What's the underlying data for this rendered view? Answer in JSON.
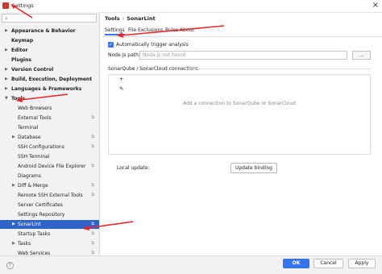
{
  "window": {
    "title": "Settings",
    "close_glyph": "×"
  },
  "sidebar": {
    "search_placeholder": "",
    "items": [
      {
        "label": "Appearance & Behavior",
        "expand": "▶",
        "bold": true
      },
      {
        "label": "Keymap",
        "expand": "",
        "bold": true
      },
      {
        "label": "Editor",
        "expand": "▶",
        "bold": true
      },
      {
        "label": "Plugins",
        "expand": "",
        "bold": true
      },
      {
        "label": "Version Control",
        "expand": "▶",
        "bold": true
      },
      {
        "label": "Build, Execution, Deployment",
        "expand": "▶",
        "bold": true
      },
      {
        "label": "Languages & Frameworks",
        "expand": "▶",
        "bold": true
      },
      {
        "label": "Tools",
        "expand": "▼",
        "bold": true
      },
      {
        "label": "Web Browsers",
        "expand": "",
        "bold": false
      },
      {
        "label": "External Tools",
        "expand": "",
        "bold": false
      },
      {
        "label": "Terminal",
        "expand": "",
        "bold": false
      },
      {
        "label": "Database",
        "expand": "▶",
        "bold": false
      },
      {
        "label": "SSH Configurations",
        "expand": "",
        "bold": false
      },
      {
        "label": "SSH Terminal",
        "expand": "",
        "bold": false
      },
      {
        "label": "Android Device File Explorer",
        "expand": "",
        "bold": false
      },
      {
        "label": "Diagrams",
        "expand": "",
        "bold": false
      },
      {
        "label": "Diff & Merge",
        "expand": "▶",
        "bold": false
      },
      {
        "label": "Remote SSH External Tools",
        "expand": "",
        "bold": false
      },
      {
        "label": "Server Certificates",
        "expand": "",
        "bold": false
      },
      {
        "label": "Settings Repository",
        "expand": "",
        "bold": false
      },
      {
        "label": "SonarLint",
        "expand": "▶",
        "bold": false,
        "selected": true
      },
      {
        "label": "Startup Tasks",
        "expand": "",
        "bold": false
      },
      {
        "label": "Tasks",
        "expand": "▶",
        "bold": false
      },
      {
        "label": "Web Services",
        "expand": "",
        "bold": false
      }
    ]
  },
  "breadcrumb": {
    "parent": "Tools",
    "separator": "›",
    "current": "SonarLint"
  },
  "tabs": [
    {
      "label": "Settings",
      "active": true
    },
    {
      "label": "File Exclusions",
      "active": false
    },
    {
      "label": "Rules",
      "active": false
    },
    {
      "label": "About",
      "active": false
    }
  ],
  "settings": {
    "auto_trigger_label": "Automatically trigger analysis",
    "auto_trigger_checked": true,
    "check_glyph": "✓",
    "node_label": "Node.js path:",
    "node_placeholder": "Node.js not found",
    "browse_label": "...",
    "sonarqube_header": "SonarQube / SonarCloud connections",
    "add_glyph": "+",
    "edit_glyph": "✎",
    "empty_connections": "Add a connection to SonarQube or SonarCloud",
    "local_update_label": "Local update:",
    "update_binding_label": "Update binding"
  },
  "footer": {
    "help_label": "?",
    "ok_label": "OK",
    "cancel_label": "Cancel",
    "apply_label": "Apply"
  },
  "icons": {
    "search": "search-icon",
    "app": "app-logo-icon",
    "settings_marker": "project-settings-icon"
  },
  "colors": {
    "accent": "#3574f0",
    "selection": "#2f65ca",
    "annotation_arrow": "#e5262a"
  }
}
